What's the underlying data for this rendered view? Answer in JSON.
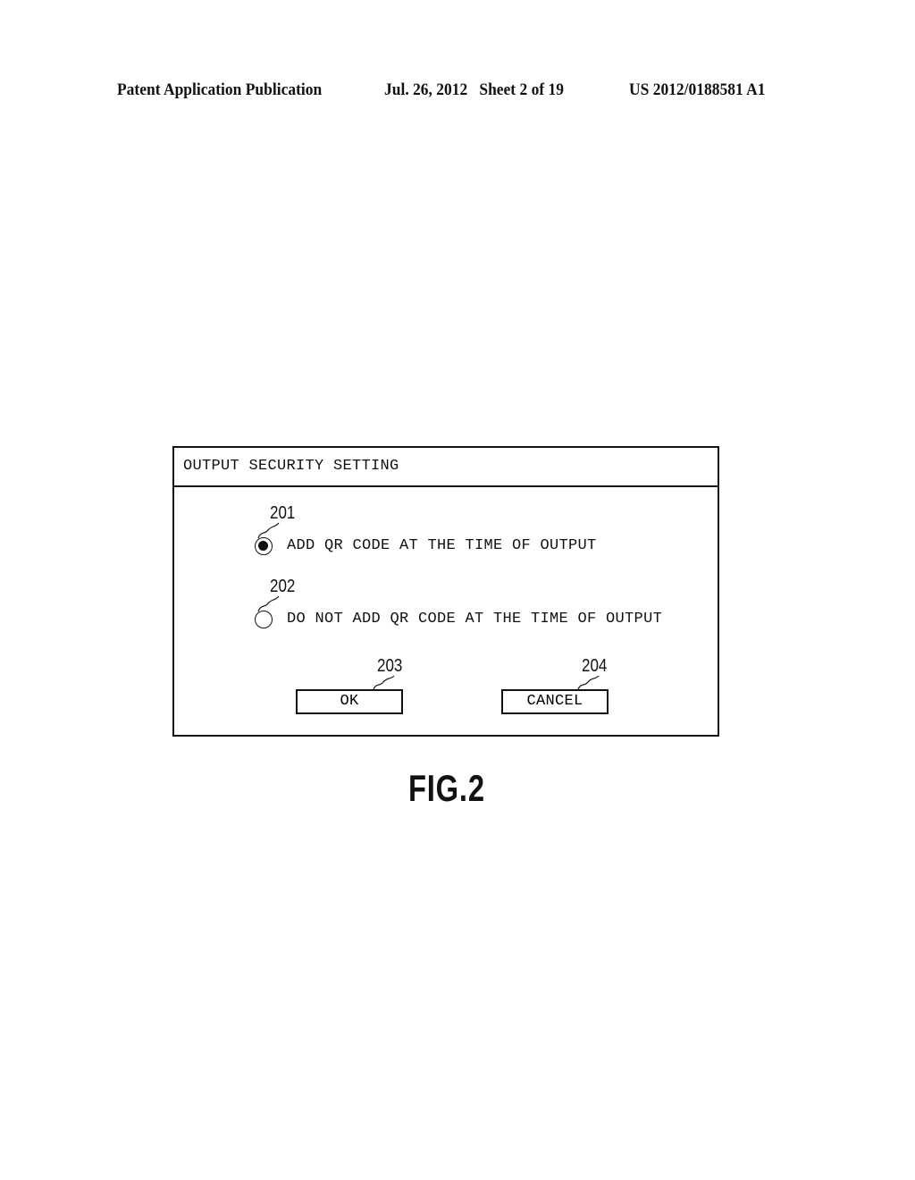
{
  "header": {
    "publication": "Patent Application Publication",
    "date_sheet": "Jul. 26, 2012   Sheet 2 of 19",
    "number": "US 2012/0188581 A1"
  },
  "dialog": {
    "title": "OUTPUT SECURITY SETTING",
    "options": [
      {
        "ref": "201",
        "label": "ADD QR CODE AT THE TIME OF OUTPUT",
        "selected": true
      },
      {
        "ref": "202",
        "label": "DO NOT ADD QR CODE AT THE TIME OF OUTPUT",
        "selected": false
      }
    ],
    "buttons": {
      "ok": {
        "ref": "203",
        "label": "OK"
      },
      "cancel": {
        "ref": "204",
        "label": "CANCEL"
      }
    }
  },
  "figure_label": "FIG.2"
}
